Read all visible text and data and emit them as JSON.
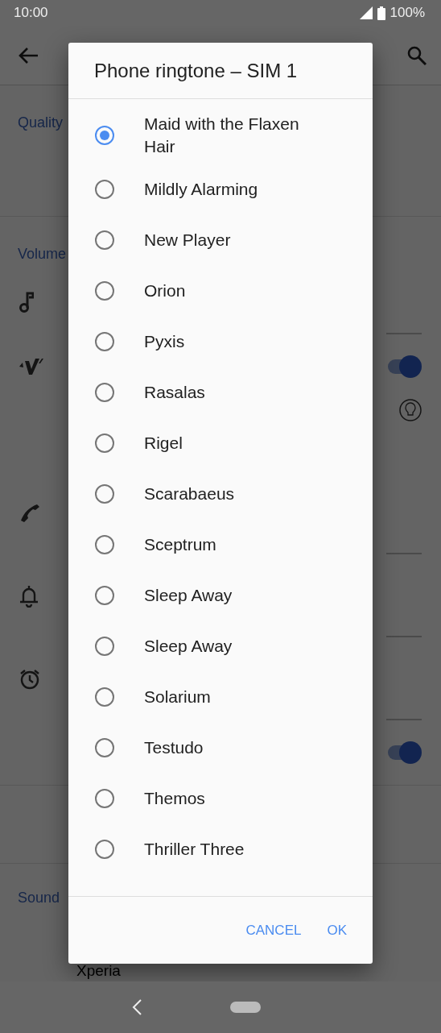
{
  "status_bar": {
    "time": "10:00",
    "battery": "100%"
  },
  "settings": {
    "sections": [
      {
        "title": "Quality"
      },
      {
        "title": "Volume"
      },
      {
        "title": "Sound"
      }
    ],
    "toggles": [
      {
        "on": true
      },
      {
        "on": true
      }
    ],
    "footer_text": "Xperia"
  },
  "dialog": {
    "title": "Phone ringtone – SIM 1",
    "options": [
      {
        "label": "Maid with the Flaxen Hair",
        "selected": true
      },
      {
        "label": "Mildly Alarming",
        "selected": false
      },
      {
        "label": "New Player",
        "selected": false
      },
      {
        "label": "Orion",
        "selected": false
      },
      {
        "label": "Pyxis",
        "selected": false
      },
      {
        "label": "Rasalas",
        "selected": false
      },
      {
        "label": "Rigel",
        "selected": false
      },
      {
        "label": "Scarabaeus",
        "selected": false
      },
      {
        "label": "Sceptrum",
        "selected": false
      },
      {
        "label": "Sleep Away",
        "selected": false
      },
      {
        "label": "Sleep Away",
        "selected": false
      },
      {
        "label": "Solarium",
        "selected": false
      },
      {
        "label": "Testudo",
        "selected": false
      },
      {
        "label": "Themos",
        "selected": false
      },
      {
        "label": "Thriller Three",
        "selected": false
      }
    ],
    "buttons": [
      "CANCEL",
      "OK"
    ]
  }
}
